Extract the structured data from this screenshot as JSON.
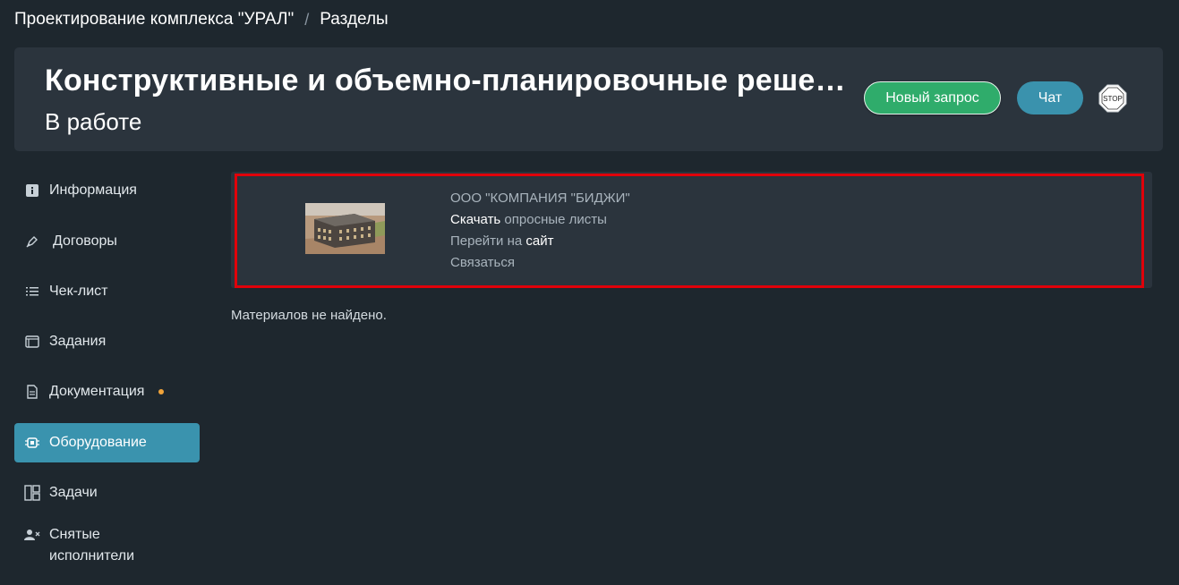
{
  "breadcrumb": {
    "project": "Проектирование комплекса \"УРАЛ\"",
    "separator": "/",
    "current": "Разделы"
  },
  "header": {
    "title": "Конструктивные и объемно-планировочные решения",
    "status": "В работе",
    "new_request_label": "Новый запрос",
    "chat_label": "Чат",
    "stop_label": "STOP"
  },
  "sidebar": {
    "items": [
      {
        "label": "Информация",
        "icon": "info-icon"
      },
      {
        "label": "Договоры",
        "icon": "pen-icon"
      },
      {
        "label": "Чек-лист",
        "icon": "checklist-icon"
      },
      {
        "label": "Задания",
        "icon": "folder-icon"
      },
      {
        "label": "Документация",
        "icon": "document-icon",
        "badge": "dot"
      },
      {
        "label": "Оборудование",
        "icon": "chip-icon",
        "active": true
      },
      {
        "label": "Задачи",
        "icon": "board-icon"
      },
      {
        "label": "Снятые исполнители",
        "icon": "user-remove-icon"
      }
    ]
  },
  "equipment": {
    "company": "ООО \"КОМПАНИЯ \"БИДЖИ\"",
    "download_link": "Скачать",
    "download_rest": "опросные листы",
    "site_prefix": "Перейти на",
    "site_link": "сайт",
    "contact_label": "Связаться"
  },
  "materials": {
    "empty_message": "Материалов не найдено."
  },
  "colors": {
    "background": "#1e272e",
    "card": "#2b343d",
    "accent_blue": "#3a93ae",
    "accent_green": "#2fac6b",
    "badge_orange": "#f0a33a",
    "highlight_red": "#e0000a"
  }
}
